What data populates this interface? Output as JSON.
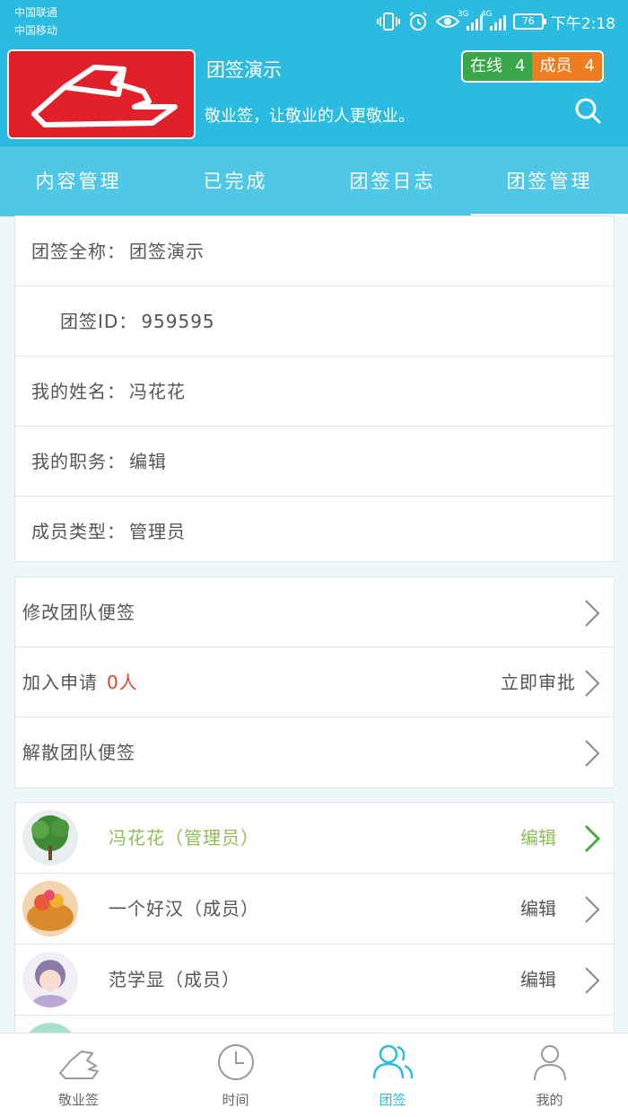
{
  "status_bar": {
    "carrier1": "中国联通",
    "carrier2": "中国移动",
    "net1": "3G",
    "net2": "4G",
    "battery": "76",
    "time": "下午2:18"
  },
  "header": {
    "team_name": "团签演示",
    "slogan": "敬业签，让敬业的人更敬业。",
    "online_label": "在线",
    "online_count": "4",
    "members_label": "成员",
    "members_count": "4"
  },
  "tabs": [
    {
      "label": "内容管理"
    },
    {
      "label": "已完成"
    },
    {
      "label": "团签日志"
    },
    {
      "label": "团签管理"
    }
  ],
  "info": {
    "fullname_label": "团签全称：",
    "fullname_value": "团签演示",
    "id_label": "团签ID：",
    "id_value": "959595",
    "myname_label": "我的姓名：",
    "myname_value": "冯花花",
    "position_label": "我的职务：",
    "position_value": "编辑",
    "type_label": "成员类型：",
    "type_value": "管理员"
  },
  "actions": {
    "edit_team": "修改团队便签",
    "join_requests": "加入申请",
    "join_count": "0人",
    "approve": "立即审批",
    "disband": "解散团队便签"
  },
  "members": [
    {
      "name": "冯花花（管理员）",
      "edit": "编辑"
    },
    {
      "name": "一个好汉（成员）",
      "edit": "编辑"
    },
    {
      "name": "范学显（成员）",
      "edit": "编辑"
    }
  ],
  "bottom_nav": [
    {
      "label": "敬业签"
    },
    {
      "label": "时间"
    },
    {
      "label": "团签"
    },
    {
      "label": "我的"
    }
  ],
  "colors": {
    "primary": "#2cbbe0",
    "tab_bar": "#4fc7e6",
    "online_badge": "#3aa64a",
    "members_badge": "#ef7d1f",
    "admin_green": "#8dbf58",
    "count_red": "#e0432e",
    "logo_red": "#e2202a"
  }
}
